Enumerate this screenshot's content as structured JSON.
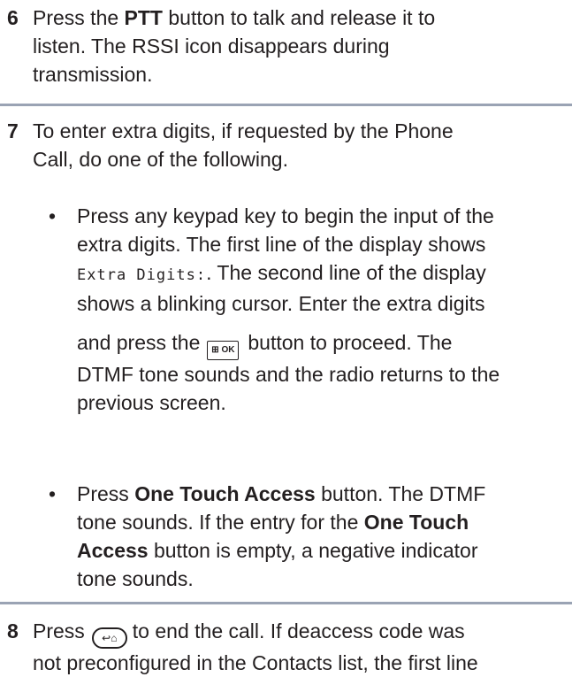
{
  "step6": {
    "num": "6",
    "line1_pre": "Press the ",
    "line1_bold": "PTT",
    "line1_post": " button to talk and release it to",
    "line2": "listen. The RSSI icon disappears during",
    "line3": "transmission."
  },
  "step7": {
    "num": "7",
    "line1": "To enter extra digits, if requested by the Phone",
    "line2": "Call, do one of the following.",
    "bullet_symbol": "•",
    "bullet1": {
      "line1": "Press any keypad key to begin the input of the",
      "line2": "extra digits. The first line of the display shows",
      "line3_mono": "Extra Digits:",
      "line3_post": ". The second line of the display",
      "line4": "shows a blinking cursor. Enter the extra digits",
      "line5_pre": "and press the",
      "ok_icon_label": "⊞ OK",
      "line5_post": "button to proceed. The",
      "line6": "DTMF tone sounds and the radio returns to the",
      "line7": "previous screen."
    },
    "bullet2": {
      "line1_pre": "Press ",
      "line1_bold": "One Touch Access",
      "line1_post": " button. The DTMF",
      "line2_pre": "tone sounds. If the entry for the ",
      "line2_bold": "One Touch",
      "line3_bold": "Access",
      "line3_post": " button is empty, a negative indicator",
      "line4": "tone sounds."
    }
  },
  "step8": {
    "num": "8",
    "line1_pre": "Press",
    "back_icon_label": "↩⌂",
    "line1_post": "to end the call. If deaccess code was",
    "line2": "not preconfigured in the Contacts list, the first line"
  },
  "colors": {
    "separator": "#9aa3b4",
    "text": "#231f20"
  }
}
